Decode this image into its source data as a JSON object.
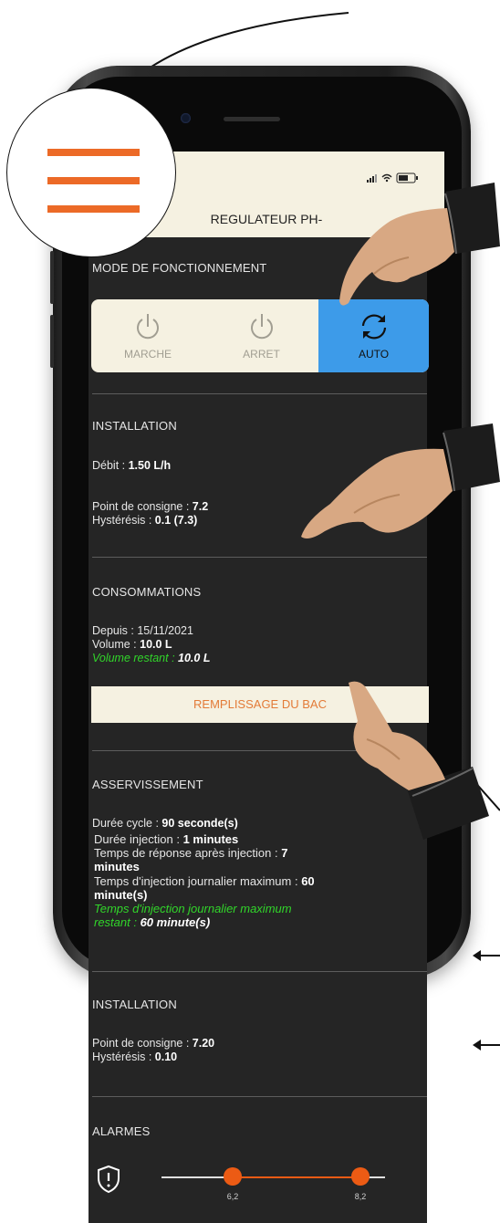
{
  "status_bar": {
    "icons": "signal-icon wifi-icon battery-icon"
  },
  "header": {
    "title": "REGULATEUR PH-"
  },
  "mode": {
    "title": "MODE DE FONCTIONNEMENT",
    "options": [
      {
        "label": "MARCHE",
        "icon": "power-icon",
        "active": false
      },
      {
        "label": "ARRET",
        "icon": "power-icon",
        "active": false
      },
      {
        "label": "AUTO",
        "icon": "refresh-icon",
        "active": true
      }
    ],
    "active_color": "#3d9be9"
  },
  "installation1": {
    "title": "INSTALLATION",
    "debit_label": "Débit : ",
    "debit_value": "1.50 L/h",
    "setpoint_label": "Point de consigne : ",
    "setpoint_value": "7.2",
    "hysteresis_label": "Hystérésis : ",
    "hysteresis_value": "0.1 (7.3)"
  },
  "consumption": {
    "title": "CONSOMMATIONS",
    "since_text": "Depuis : 15/11/2021",
    "volume_label": "Volume : ",
    "volume_value": "10.0 L",
    "remaining_label": "Volume restant : ",
    "remaining_value": "10.0 L",
    "refill_button": "REMPLISSAGE DU BAC"
  },
  "servo": {
    "title": "ASSERVISSEMENT",
    "cycle_label": "Durée cycle : ",
    "cycle_value": "90 seconde(s)",
    "injection_label": "Durée injection : ",
    "injection_value": "1 minutes",
    "response_label": "Temps de réponse après injection : ",
    "response_value_1": "7",
    "response_value_2": "minutes",
    "max_label": "Temps d'injection journalier maximum : ",
    "max_value_1": "60",
    "max_value_2": "minute(s)",
    "max_remaining_line1": "Temps d'injection journalier maximum",
    "max_remaining_line2_label": "restant : ",
    "max_remaining_value": "60 minute(s)"
  },
  "installation2": {
    "title": "INSTALLATION",
    "setpoint_label": "Point de consigne : ",
    "setpoint_value": "7.20",
    "hysteresis_label": "Hystérésis : ",
    "hysteresis_value": "0.10"
  },
  "alarms": {
    "title": "ALARMES",
    "icon": "shield-alert-icon",
    "min_value": "6,2",
    "max_value": "8,2",
    "slider_color": "#ec5b14"
  },
  "colors": {
    "accent_orange": "#ec6a27",
    "green_text": "#31d62a",
    "screen_bg": "#252525",
    "cream": "#f5f1e1"
  }
}
